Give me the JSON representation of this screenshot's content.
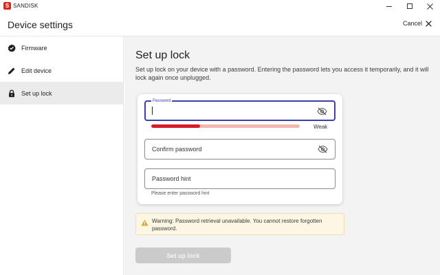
{
  "window": {
    "app_name": "SANDISK",
    "app_logo_letter": "S",
    "brand_color": "#e2231a"
  },
  "header": {
    "title": "Device settings",
    "cancel_label": "Cancel"
  },
  "sidebar": {
    "items": [
      {
        "label": "Firmware",
        "icon": "check-badge-icon",
        "active": false
      },
      {
        "label": "Edit device",
        "icon": "pencil-icon",
        "active": false
      },
      {
        "label": "Set up lock",
        "icon": "lock-icon",
        "active": true
      }
    ]
  },
  "main": {
    "title": "Set up lock",
    "description": "Set up lock on your device with a password. Entering the password lets you access it temporarily, and it will lock again once unplugged.",
    "password": {
      "label": "Password",
      "value": "",
      "strength_label": "Weak",
      "strength_fraction": 0.33
    },
    "confirm_password": {
      "placeholder": "Confirm password",
      "value": ""
    },
    "password_hint": {
      "placeholder": "Password hint",
      "value": "",
      "helper": "Please enter password hint"
    },
    "warning": "Warning: Password retrieval unavailable. You cannot restore forgotten password.",
    "submit_label": "Set up lock"
  },
  "colors": {
    "accent": "#3a3fa8",
    "strength_fill": "#d91a2a",
    "strength_track": "#f5b6ae",
    "warning_bg": "#fdf6e3",
    "warning_icon": "#e0a82e",
    "button_disabled": "#cbcbcb"
  }
}
